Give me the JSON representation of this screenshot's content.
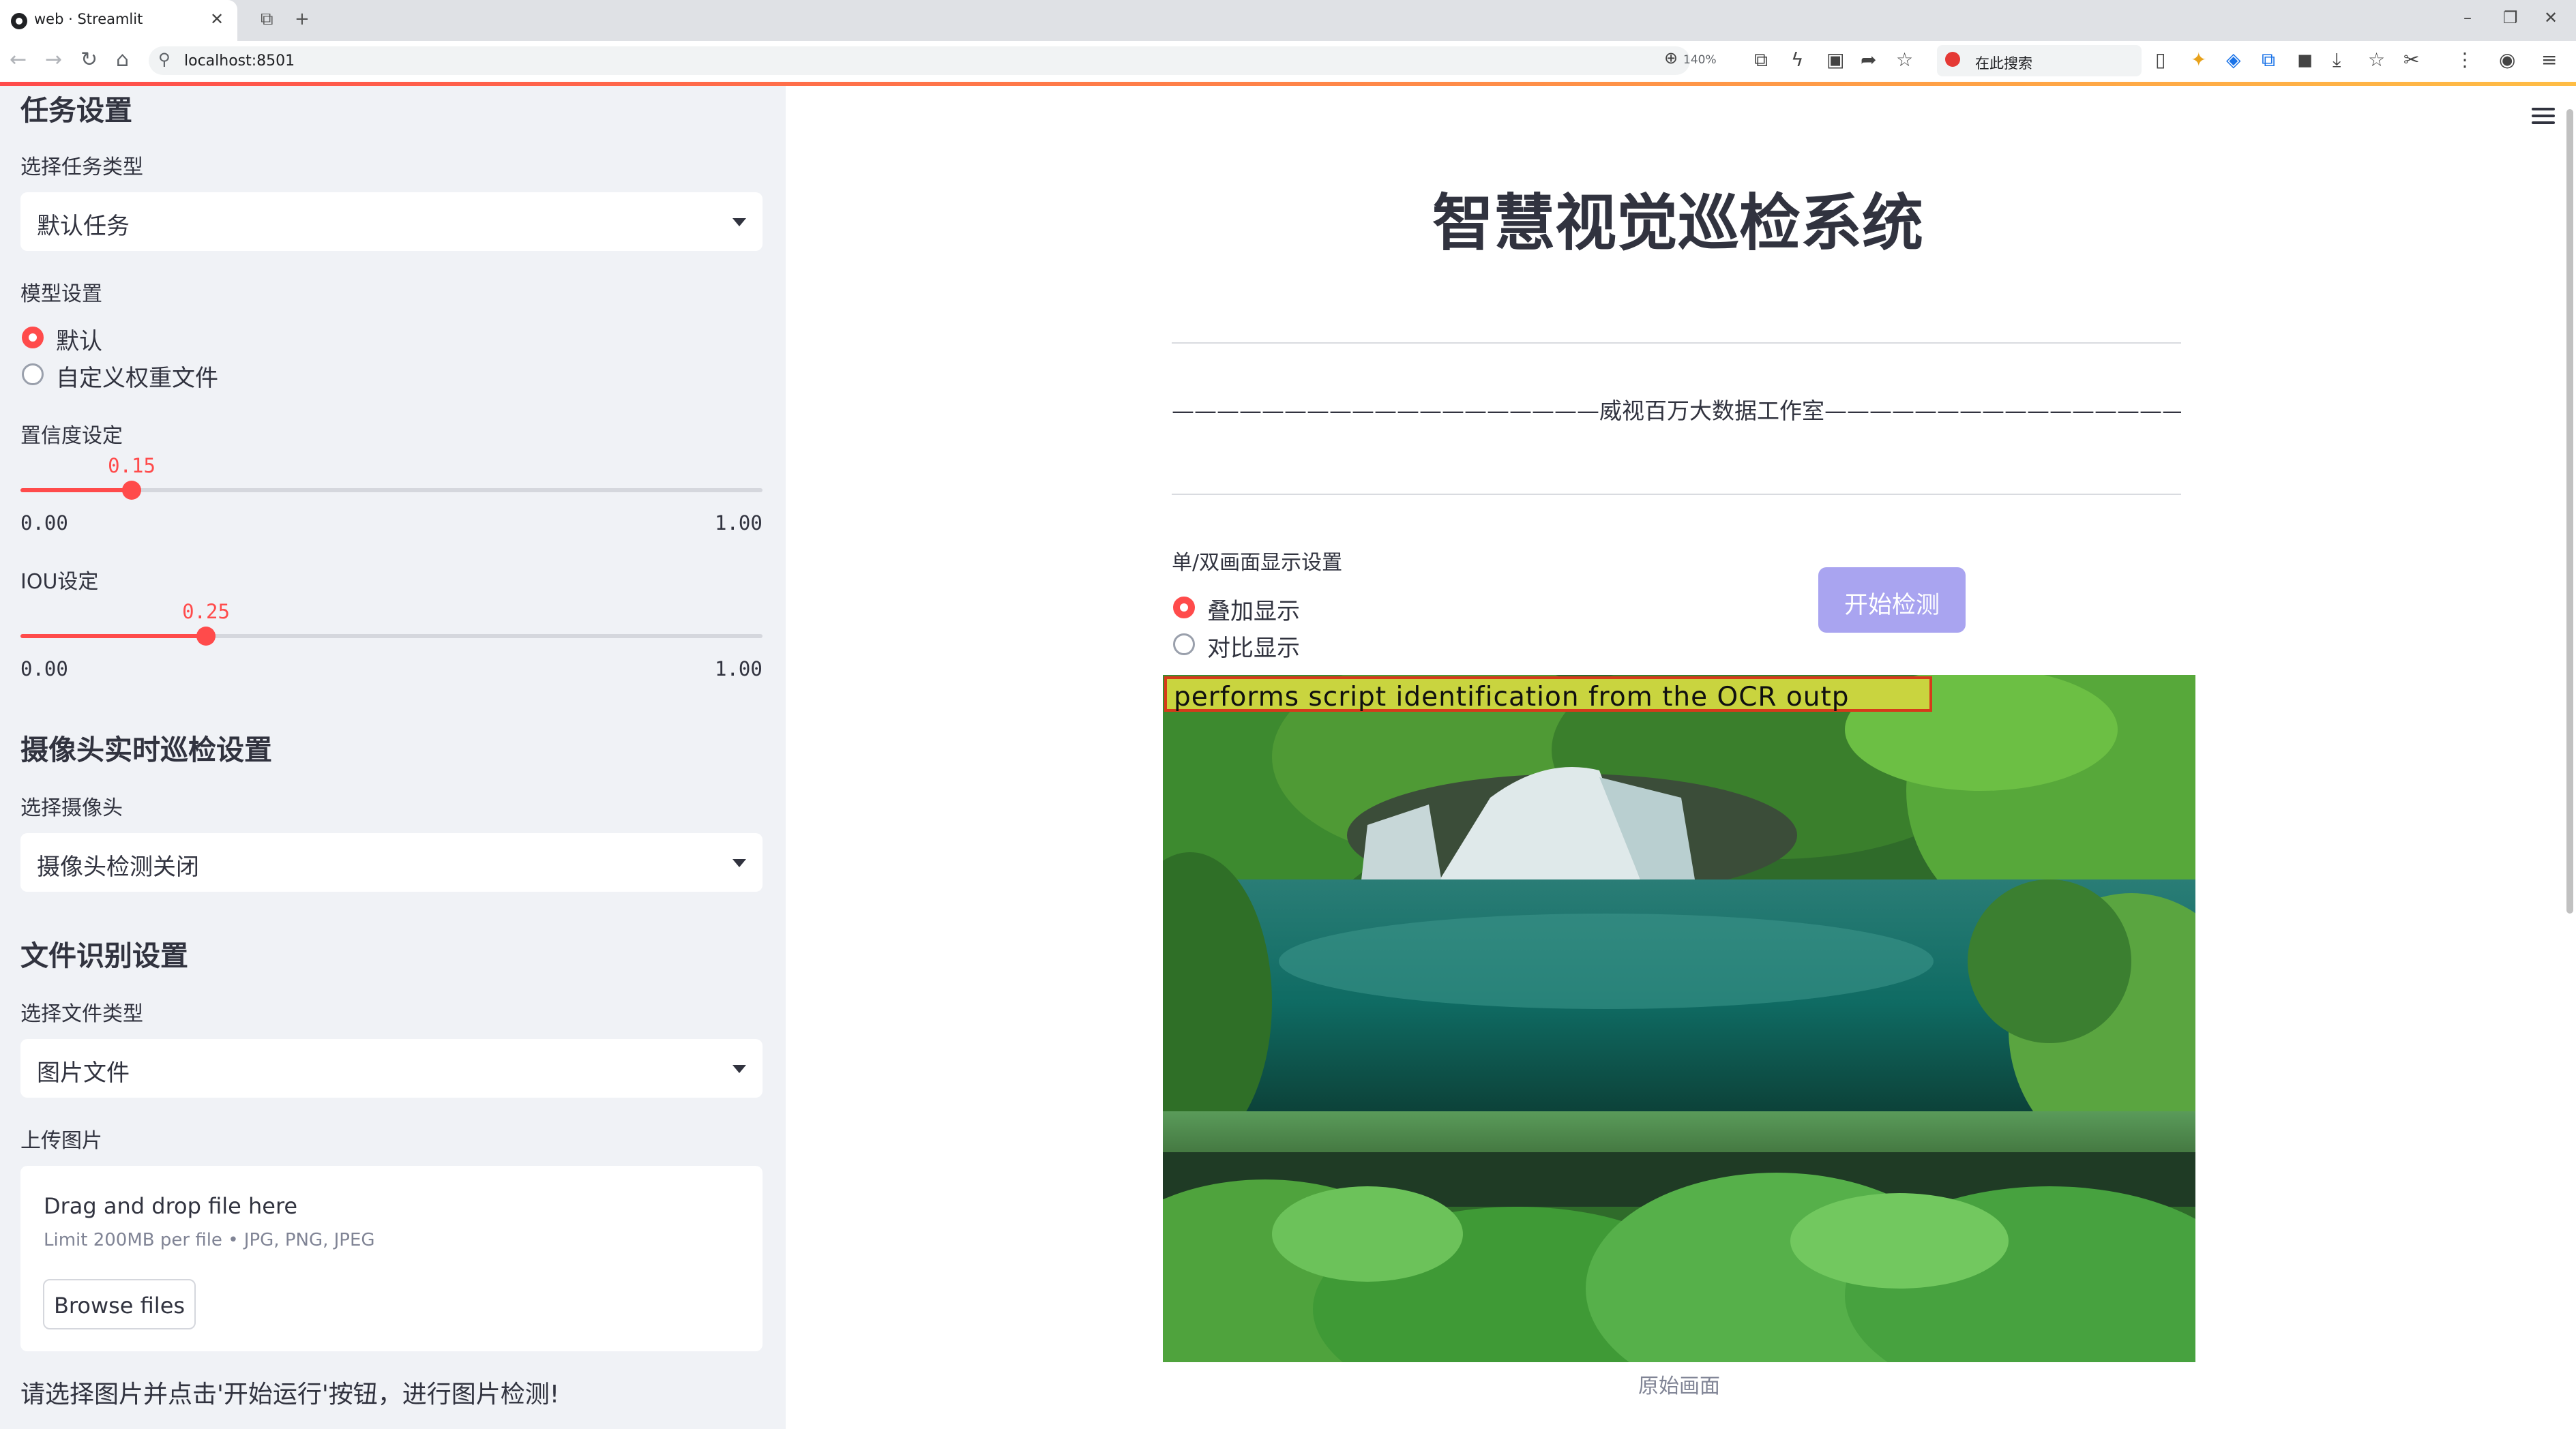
{
  "browser": {
    "tab_title": "web · Streamlit",
    "url": "localhost:8501",
    "zoom": "140%",
    "search_placeholder": "在此搜索"
  },
  "sidebar": {
    "task_heading": "任务设置",
    "task_type_label": "选择任务类型",
    "task_type_value": "默认任务",
    "model_label": "模型设置",
    "model_options": [
      "默认",
      "自定义权重文件"
    ],
    "model_selected": "默认",
    "confidence": {
      "label": "置信度设定",
      "value": "0.15",
      "min": "0.00",
      "max": "1.00",
      "fraction": 0.15
    },
    "iou": {
      "label": "IOU设定",
      "value": "0.25",
      "min": "0.00",
      "max": "1.00",
      "fraction": 0.25
    },
    "camera_heading": "摄像头实时巡检设置",
    "camera_label": "选择摄像头",
    "camera_value": "摄像头检测关闭",
    "file_heading": "文件识别设置",
    "file_type_label": "选择文件类型",
    "file_type_value": "图片文件",
    "upload_label": "上传图片",
    "upload_title": "Drag and drop file here",
    "upload_limit": "Limit 200MB per file • JPG, PNG, JPEG",
    "browse_label": "Browse files",
    "note": "请选择图片并点击'开始运行'按钮，进行图片检测!"
  },
  "main": {
    "title": "智慧视觉巡检系统",
    "studio_line": "———————————————————威视百万大数据工作室———————————————————",
    "display_label": "单/双画面显示设置",
    "display_options": [
      "叠加显示",
      "对比显示"
    ],
    "display_selected": "叠加显示",
    "detect_button": "开始检测",
    "ocr_text": "performs script identification from the OCR outp",
    "caption": "原始画面"
  },
  "colors": {
    "accent": "#ff4b4b",
    "sidebar_bg": "#f0f2f6",
    "button_disabled": "#a9a4f0"
  }
}
